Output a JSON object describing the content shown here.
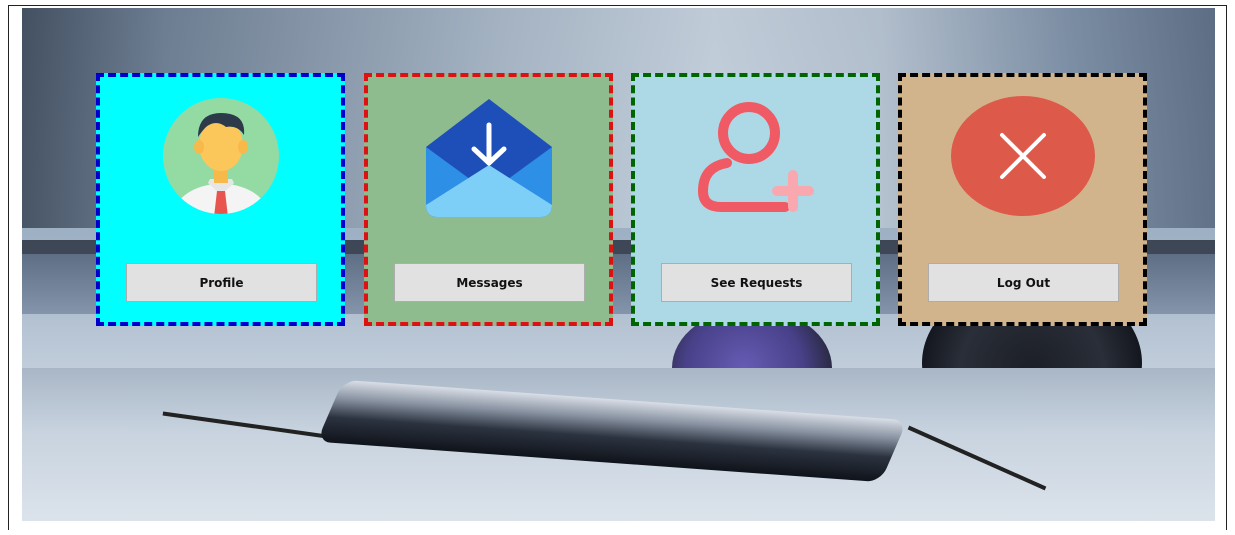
{
  "background": {
    "description_icon": "phone-headphones-photo"
  },
  "cards": [
    {
      "id": "profile",
      "button_label": "Profile",
      "icon": "user-avatar-icon",
      "bg_color": "#00ffff",
      "border_color": "#0000cc"
    },
    {
      "id": "messages",
      "button_label": "Messages",
      "icon": "mail-download-icon",
      "bg_color": "#8fbc8f",
      "border_color": "#dd1111"
    },
    {
      "id": "requests",
      "button_label": "See Requests",
      "icon": "add-user-icon",
      "bg_color": "#add8e6",
      "border_color": "#006400"
    },
    {
      "id": "logout",
      "button_label": "Log Out",
      "icon": "close-circle-icon",
      "bg_color": "#d2b48c",
      "border_color": "#000000"
    }
  ]
}
